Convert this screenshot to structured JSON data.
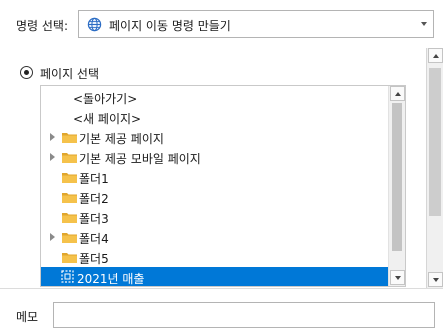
{
  "command": {
    "label": "명령 선택:",
    "value": "페이지 이동 명령 만들기",
    "icon": "globe-icon"
  },
  "page_select": {
    "radio_label": "페이지 선택",
    "selected": true
  },
  "tree": {
    "items": [
      {
        "label": "<돌아가기>",
        "type": "special",
        "expandable": false
      },
      {
        "label": "<새 페이지>",
        "type": "special",
        "expandable": false
      },
      {
        "label": "기본 제공 페이지",
        "type": "folder",
        "expandable": true
      },
      {
        "label": "기본 제공 모바일 페이지",
        "type": "folder",
        "expandable": true
      },
      {
        "label": "폴더1",
        "type": "folder",
        "expandable": false
      },
      {
        "label": "폴더2",
        "type": "folder",
        "expandable": false
      },
      {
        "label": "폴더3",
        "type": "folder",
        "expandable": false
      },
      {
        "label": "폴더4",
        "type": "folder",
        "expandable": true
      },
      {
        "label": "폴더5",
        "type": "folder",
        "expandable": false
      },
      {
        "label": "2021년 매출",
        "type": "page",
        "expandable": false,
        "selected": true
      }
    ]
  },
  "memo": {
    "label": "메모",
    "value": ""
  },
  "colors": {
    "selection": "#0078d7",
    "folder": "#f5c24b",
    "folder_dark": "#e0a62d"
  }
}
